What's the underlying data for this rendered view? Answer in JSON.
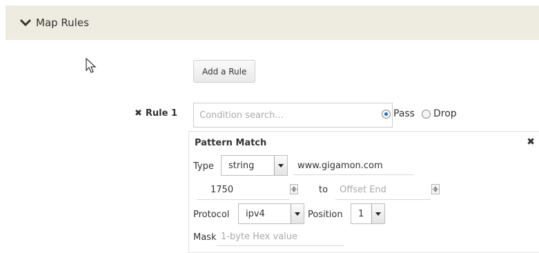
{
  "section": {
    "title": "Map Rules"
  },
  "add_rule_button": "Add a Rule",
  "rule": {
    "label": "Rule 1",
    "condition_placeholder": "Condition search...",
    "actions": [
      {
        "label": "Pass",
        "selected": true
      },
      {
        "label": "Drop",
        "selected": false
      }
    ]
  },
  "pattern_match": {
    "title": "Pattern Match",
    "type_label": "Type",
    "type_value": "string",
    "pattern_value": "www.gigamon.com",
    "offset_start": "1750",
    "to_label": "to",
    "offset_end_placeholder": "Offset End",
    "protocol_label": "Protocol",
    "protocol_value": "ipv4",
    "position_label": "Position",
    "position_value": "1",
    "mask_label": "Mask",
    "mask_placeholder": "1-byte Hex value"
  }
}
